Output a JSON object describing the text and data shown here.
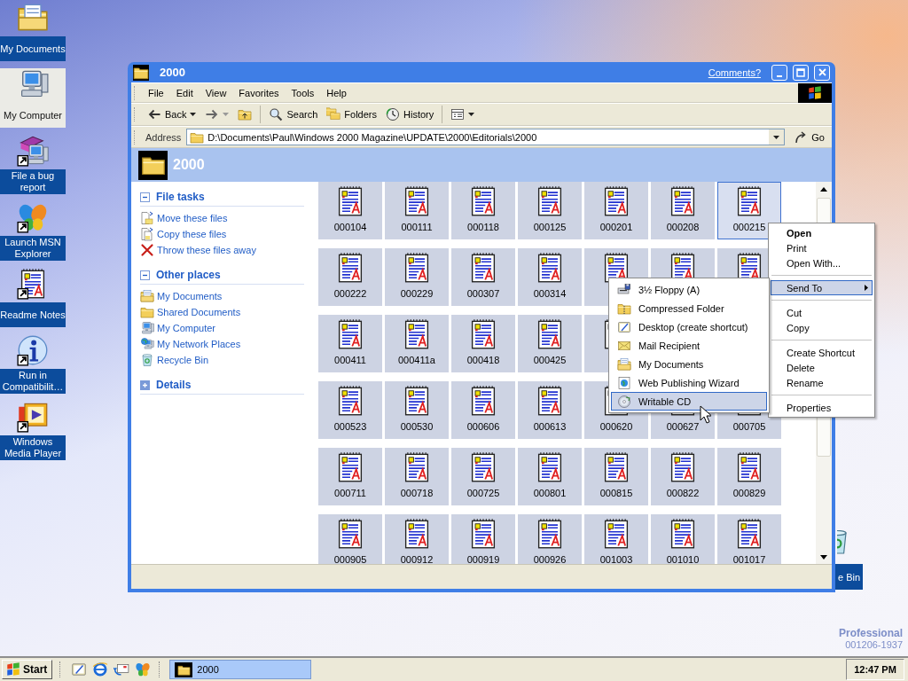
{
  "desktop_icons": [
    {
      "label": "My Documents",
      "kind": "documents",
      "shortcut": false,
      "selected": false
    },
    {
      "label": "My Computer",
      "kind": "computer",
      "shortcut": false,
      "selected": true
    },
    {
      "label": "File a bug report",
      "kind": "bug",
      "shortcut": true,
      "selected": false
    },
    {
      "label": "Launch MSN Explorer",
      "kind": "msn",
      "shortcut": true,
      "selected": false
    },
    {
      "label": "Readme Notes",
      "kind": "notes",
      "shortcut": true,
      "selected": false
    },
    {
      "label": "Run in Compatibilit…",
      "kind": "info",
      "shortcut": true,
      "selected": false
    },
    {
      "label": "Windows Media Player",
      "kind": "media",
      "shortcut": true,
      "selected": false
    }
  ],
  "recycle_bin": {
    "label": "e Bin"
  },
  "version_text": [
    "Professional",
    "001206-1937"
  ],
  "window": {
    "title": "2000",
    "comments_link": "Comments?",
    "menu": [
      "File",
      "Edit",
      "View",
      "Favorites",
      "Tools",
      "Help"
    ],
    "toolbar": [
      {
        "kind": "back",
        "label": "Back",
        "dropdown": true
      },
      {
        "kind": "forward",
        "dropdown": true
      },
      {
        "kind": "up"
      },
      {
        "kind": "search",
        "label": "Search"
      },
      {
        "kind": "folders",
        "label": "Folders"
      },
      {
        "kind": "history",
        "label": "History"
      },
      {
        "kind": "views",
        "dropdown": true
      }
    ],
    "address": {
      "label": "Address",
      "value": "D:\\Documents\\Paul\\Windows 2000 Magazine\\UPDATE\\2000\\Editorials\\2000",
      "go": "Go"
    },
    "header": "2000",
    "task_panes": [
      {
        "title": "File tasks",
        "expanded": true,
        "items": [
          {
            "label": "Move these files",
            "kind": "move"
          },
          {
            "label": "Copy these files",
            "kind": "copy"
          },
          {
            "label": "Throw these files away",
            "kind": "delete"
          }
        ]
      },
      {
        "title": "Other places",
        "expanded": true,
        "items": [
          {
            "label": "My Documents",
            "kind": "documents"
          },
          {
            "label": "Shared Documents",
            "kind": "folder"
          },
          {
            "label": "My Computer",
            "kind": "computer"
          },
          {
            "label": "My Network Places",
            "kind": "network"
          },
          {
            "label": "Recycle Bin",
            "kind": "recycle"
          }
        ]
      },
      {
        "title": "Details",
        "expanded": false
      }
    ],
    "file_rows": [
      [
        {
          "label": "000104",
          "selected": false
        },
        {
          "label": "000111",
          "selected": false
        },
        {
          "label": "000118",
          "selected": false
        },
        {
          "label": "000125",
          "selected": false
        },
        {
          "label": "000201",
          "selected": false
        },
        {
          "label": "000208",
          "selected": false
        },
        {
          "label": "000215",
          "selected": true
        }
      ],
      [
        {
          "label": "000222",
          "selected": false
        },
        {
          "label": "000229",
          "selected": false
        },
        {
          "label": "000307",
          "selected": false
        },
        {
          "label": "000314",
          "selected": false
        },
        {
          "selected": false
        },
        {
          "selected": false
        },
        {
          "selected": false
        }
      ],
      [
        {
          "label": "000411",
          "selected": false
        },
        {
          "label": "000411a",
          "selected": false
        },
        {
          "label": "000418",
          "selected": false
        },
        {
          "label": "000425",
          "selected": false
        },
        {
          "selected": false
        }
      ],
      [
        {
          "label": "000523",
          "selected": false
        },
        {
          "label": "000530",
          "selected": false
        },
        {
          "label": "000606",
          "selected": false
        },
        {
          "label": "000613",
          "selected": false
        },
        {
          "label": "000620",
          "selected": false
        },
        {
          "label": "000627",
          "selected": false
        },
        {
          "label": "000705",
          "selected": false
        }
      ],
      [
        {
          "label": "000711",
          "selected": false
        },
        {
          "label": "000718",
          "selected": false
        },
        {
          "label": "000725",
          "selected": false
        },
        {
          "label": "000801",
          "selected": false
        },
        {
          "label": "000815",
          "selected": false
        },
        {
          "label": "000822",
          "selected": false
        },
        {
          "label": "000829",
          "selected": false
        }
      ],
      [
        {
          "label": "000905",
          "selected": false
        },
        {
          "label": "000912",
          "selected": false
        },
        {
          "label": "000919",
          "selected": false
        },
        {
          "label": "000926",
          "selected": false
        },
        {
          "label": "001003",
          "selected": false
        },
        {
          "label": "001010",
          "selected": false
        },
        {
          "label": "001017",
          "selected": false
        }
      ]
    ]
  },
  "context_menu": {
    "items": [
      {
        "kind": "item",
        "label": "Open",
        "default": true,
        "submenu": false,
        "selected": false
      },
      {
        "kind": "item",
        "label": "Print",
        "default": false,
        "submenu": false,
        "selected": false
      },
      {
        "kind": "item",
        "label": "Open With...",
        "default": false,
        "submenu": false,
        "selected": false
      },
      {
        "kind": "separator"
      },
      {
        "kind": "item",
        "label": "Send To",
        "default": false,
        "submenu": true,
        "selected": true
      },
      {
        "kind": "separator"
      },
      {
        "kind": "item",
        "label": "Cut",
        "default": false,
        "submenu": false,
        "selected": false
      },
      {
        "kind": "item",
        "label": "Copy",
        "default": false,
        "submenu": false,
        "selected": false
      },
      {
        "kind": "separator"
      },
      {
        "kind": "item",
        "label": "Create Shortcut",
        "default": false,
        "submenu": false,
        "selected": false
      },
      {
        "kind": "item",
        "label": "Delete",
        "default": false,
        "submenu": false,
        "selected": false
      },
      {
        "kind": "item",
        "label": "Rename",
        "default": false,
        "submenu": false,
        "selected": false
      },
      {
        "kind": "separator"
      },
      {
        "kind": "item",
        "label": "Properties",
        "default": false,
        "submenu": false,
        "selected": false
      }
    ]
  },
  "send_to_menu": {
    "items": [
      {
        "label": "3½ Floppy (A)",
        "kind": "floppy",
        "selected": false
      },
      {
        "label": "Compressed Folder",
        "kind": "zip",
        "selected": false
      },
      {
        "label": "Desktop (create shortcut)",
        "kind": "desktop",
        "selected": false
      },
      {
        "label": "Mail Recipient",
        "kind": "mail",
        "selected": false
      },
      {
        "label": "My Documents",
        "kind": "documents",
        "selected": false
      },
      {
        "label": "Web Publishing Wizard",
        "kind": "wizard",
        "selected": false
      },
      {
        "label": "Writable CD",
        "kind": "cd",
        "selected": true
      }
    ]
  },
  "taskbar": {
    "start": "Start",
    "quick_launch": [
      {
        "kind": "desktop"
      },
      {
        "kind": "ie"
      },
      {
        "kind": "sync"
      },
      {
        "kind": "msn"
      }
    ],
    "tasks": [
      {
        "label": "2000",
        "selected": true
      }
    ],
    "clock": "12:47 PM"
  }
}
